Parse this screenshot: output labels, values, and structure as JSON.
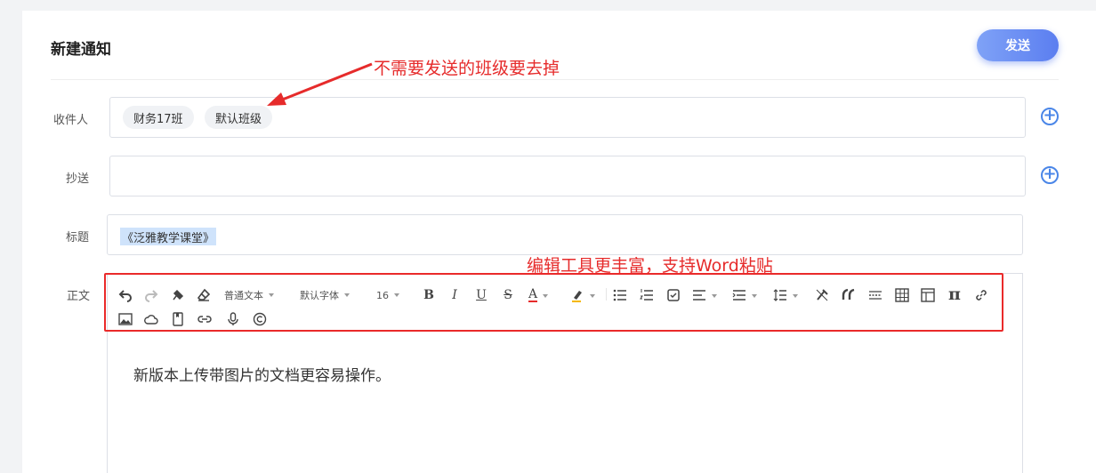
{
  "page": {
    "title": "新建通知",
    "send_label": "发送"
  },
  "recipients": {
    "label": "收件人",
    "tags": [
      "财务17班",
      "默认班级"
    ]
  },
  "cc": {
    "label": "抄送",
    "value": ""
  },
  "subject": {
    "label": "标题",
    "value": "《泛雅教学课堂》"
  },
  "body": {
    "label": "正文",
    "content": "新版本上传带图片的文档更容易操作。",
    "toolbar": {
      "paragraph": "普通文本",
      "font": "默认字体",
      "size": "16",
      "bold": "B",
      "italic": "I",
      "underline": "U",
      "strike": "S",
      "font_color": "A",
      "pi": "π"
    }
  },
  "annotations": {
    "remove_class": "不需要发送的班级要去掉",
    "editor_tools": "编辑工具更丰富，支持Word粘贴"
  },
  "colors": {
    "accent": "#5b7ef0",
    "annotation": "#e62b2b",
    "plus": "#4a86e8"
  }
}
